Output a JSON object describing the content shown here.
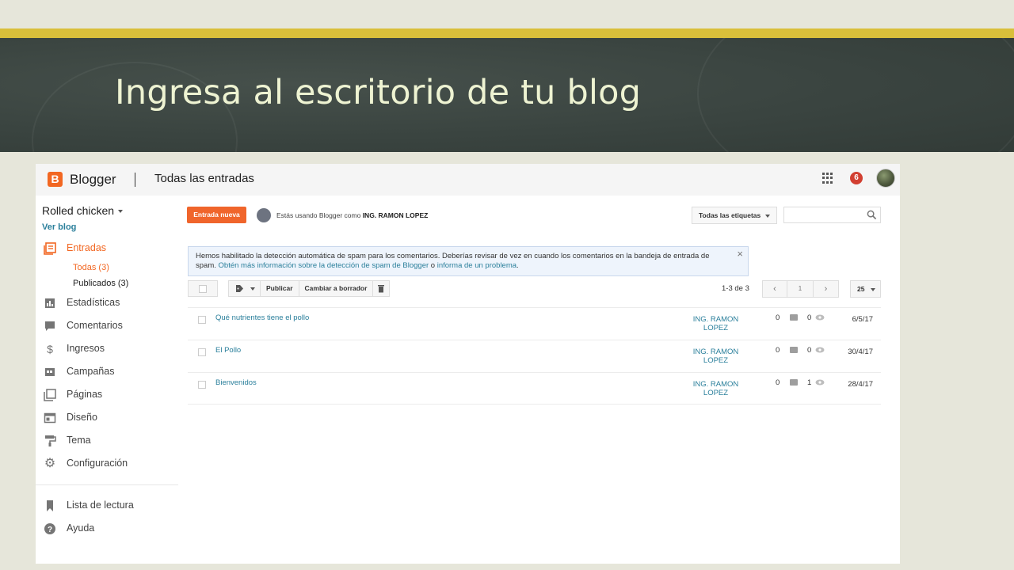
{
  "slide": {
    "title": "Ingresa al escritorio de tu blog"
  },
  "header": {
    "logo_letter": "B",
    "brand": "Blogger",
    "page_heading": "Todas las entradas",
    "notification_count": "6"
  },
  "sidebar": {
    "blog_name": "Rolled chicken",
    "view_blog": "Ver blog",
    "items": [
      {
        "label": "Entradas",
        "icon": "posts-icon",
        "active": true
      },
      {
        "label": "Estadísticas",
        "icon": "stats-icon"
      },
      {
        "label": "Comentarios",
        "icon": "comments-icon"
      },
      {
        "label": "Ingresos",
        "icon": "dollar-icon"
      },
      {
        "label": "Campañas",
        "icon": "campaigns-icon"
      },
      {
        "label": "Páginas",
        "icon": "pages-icon"
      },
      {
        "label": "Diseño",
        "icon": "layout-icon"
      },
      {
        "label": "Tema",
        "icon": "theme-icon"
      },
      {
        "label": "Configuración",
        "icon": "gear-icon"
      }
    ],
    "sub_items": [
      {
        "label": "Todas (3)",
        "active": true
      },
      {
        "label": "Publicados (3)"
      }
    ],
    "bottom_items": [
      {
        "label": "Lista de lectura",
        "icon": "bookmark-icon"
      },
      {
        "label": "Ayuda",
        "icon": "help-icon"
      }
    ]
  },
  "main": {
    "new_post": "Entrada nueva",
    "user_note": "Estás usando Blogger como ",
    "user_name": "ING. RAMON LOPEZ",
    "label_filter": "Todas las etiquetas",
    "notice": {
      "text": "Hemos habilitado la detección automática de spam para los comentarios. Deberías revisar de vez en cuando los comentarios en la bandeja de entrada de spam. ",
      "link1": "Obtén más información sobre la detección de spam de Blogger",
      "connector": " o ",
      "link2": "informa de un problema",
      "tail": ".",
      "close": "×"
    },
    "toolbar": {
      "publish": "Publicar",
      "draft": "Cambiar a borrador"
    },
    "range": "1-3 de 3",
    "pager": {
      "prev": "‹",
      "page": "1",
      "next": "›"
    },
    "per_page": "25",
    "posts": [
      {
        "title": "Qué nutrientes tiene el pollo",
        "author": "ING. RAMON LOPEZ",
        "comments": "0",
        "views": "0",
        "date": "6/5/17"
      },
      {
        "title": "El Pollo",
        "author": "ING. RAMON LOPEZ",
        "comments": "0",
        "views": "0",
        "date": "30/4/17"
      },
      {
        "title": "Bienvenidos",
        "author": "ING. RAMON LOPEZ",
        "comments": "0",
        "views": "1",
        "date": "28/4/17"
      }
    ]
  },
  "colors": {
    "accent": "#f26722",
    "link": "#2a7f9b",
    "gold_band": "#d9bf3a",
    "chalkboard": "#3a4440"
  }
}
